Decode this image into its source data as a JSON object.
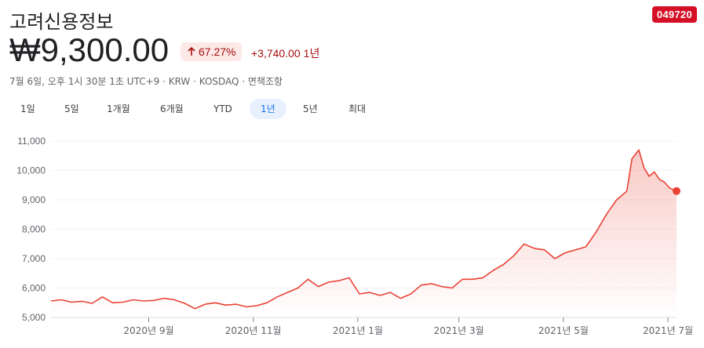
{
  "header": {
    "title": "고려신용정보",
    "ticker": "049720",
    "price": "₩9,300.00",
    "change_pct": "67.27%",
    "change_abs": "+3,740.00",
    "change_period": "1년",
    "meta": "7월 6일, 오후 1시 30분 1초 UTC+9 · KRW · KOSDAQ · 면책조항"
  },
  "tabs": [
    {
      "label": "1일",
      "active": false
    },
    {
      "label": "5일",
      "active": false
    },
    {
      "label": "1개월",
      "active": false
    },
    {
      "label": "6개월",
      "active": false
    },
    {
      "label": "YTD",
      "active": false
    },
    {
      "label": "1년",
      "active": true
    },
    {
      "label": "5년",
      "active": false
    },
    {
      "label": "최대",
      "active": false
    }
  ],
  "colors": {
    "line": "#e94235",
    "negative_badge_bg": "#fce8e6",
    "text_red": "#a50e0e",
    "ticker_bg": "#d50f25",
    "active_tab_bg": "#e8f0fe",
    "active_tab_text": "#1a73e8"
  },
  "icons": {
    "change_arrow": "arrow-up-icon"
  },
  "chart_data": {
    "type": "area",
    "ylim": [
      5000,
      11000
    ],
    "y_ticks": [
      5000,
      6000,
      7000,
      8000,
      9000,
      10000,
      11000
    ],
    "y_tick_labels": [
      "5,000",
      "6,000",
      "7,000",
      "8,000",
      "9,000",
      "10,000",
      "11,000"
    ],
    "x_tick_labels": [
      "2020년 9월",
      "2020년 11월",
      "2021년 1월",
      "2021년 3월",
      "2021년 5월",
      "2021년 7월"
    ],
    "x_ticks": [
      "2020-09-01",
      "2020-11-01",
      "2021-01-01",
      "2021-03-01",
      "2021-05-01",
      "2021-07-01"
    ],
    "x_range": [
      "2020-07-06",
      "2021-07-06"
    ],
    "grid": true,
    "series": [
      {
        "dates": [
          "2020-07-06",
          "2020-07-12",
          "2020-07-18",
          "2020-07-24",
          "2020-07-30",
          "2020-08-05",
          "2020-08-11",
          "2020-08-17",
          "2020-08-23",
          "2020-08-29",
          "2020-09-04",
          "2020-09-10",
          "2020-09-16",
          "2020-09-22",
          "2020-09-28",
          "2020-10-04",
          "2020-10-10",
          "2020-10-16",
          "2020-10-22",
          "2020-10-28",
          "2020-11-03",
          "2020-11-09",
          "2020-11-15",
          "2020-11-21",
          "2020-11-27",
          "2020-12-03",
          "2020-12-09",
          "2020-12-15",
          "2020-12-21",
          "2020-12-27",
          "2021-01-02",
          "2021-01-08",
          "2021-01-14",
          "2021-01-20",
          "2021-01-26",
          "2021-02-01",
          "2021-02-07",
          "2021-02-13",
          "2021-02-19",
          "2021-02-25",
          "2021-03-03",
          "2021-03-09",
          "2021-03-15",
          "2021-03-21",
          "2021-03-27",
          "2021-04-02",
          "2021-04-08",
          "2021-04-14",
          "2021-04-20",
          "2021-04-26",
          "2021-05-02",
          "2021-05-08",
          "2021-05-14",
          "2021-05-20",
          "2021-05-26",
          "2021-06-01",
          "2021-06-07",
          "2021-06-10",
          "2021-06-14",
          "2021-06-17",
          "2021-06-20",
          "2021-06-23",
          "2021-06-26",
          "2021-06-29",
          "2021-07-02",
          "2021-07-06"
        ],
        "values": [
          5560,
          5600,
          5520,
          5550,
          5480,
          5700,
          5500,
          5520,
          5600,
          5560,
          5580,
          5650,
          5600,
          5480,
          5300,
          5450,
          5500,
          5420,
          5450,
          5360,
          5400,
          5500,
          5700,
          5850,
          6000,
          6300,
          6050,
          6200,
          6250,
          6350,
          5800,
          5850,
          5750,
          5850,
          5650,
          5800,
          6100,
          6150,
          6050,
          6000,
          6300,
          6300,
          6350,
          6600,
          6800,
          7100,
          7500,
          7350,
          7300,
          7000,
          7200,
          7300,
          7400,
          7900,
          8500,
          9000,
          9300,
          10400,
          10700,
          10100,
          9800,
          9950,
          9700,
          9600,
          9400,
          9300
        ]
      }
    ]
  }
}
